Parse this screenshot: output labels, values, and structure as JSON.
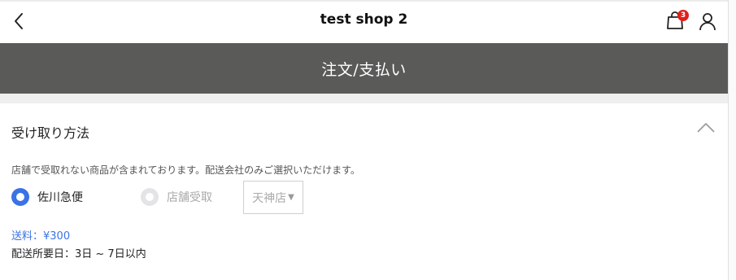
{
  "topbar": {
    "title": "test shop 2",
    "cart_count": "3",
    "icons": {
      "back": "chevron-left-icon",
      "cart": "shopping-bag-icon",
      "user": "user-icon"
    }
  },
  "page_header": {
    "title": "注文/支払い"
  },
  "receive_section": {
    "title": "受け取り方法",
    "notice": "店舗で受取れない商品が含まれております。配送会社のみご選択いただけます。",
    "options": [
      {
        "label": "佐川急便",
        "selected": true,
        "enabled": true
      },
      {
        "label": "店舗受取",
        "selected": false,
        "enabled": false
      }
    ],
    "store_select": {
      "value": "天神店"
    },
    "shipping_fee": "送料：¥300",
    "delivery_days": "配送所要日：3日 ~ 7日以内"
  },
  "colors": {
    "header_bg": "#5a5a59",
    "accent_blue": "#3a73e6",
    "badge_red": "#e0201c"
  }
}
